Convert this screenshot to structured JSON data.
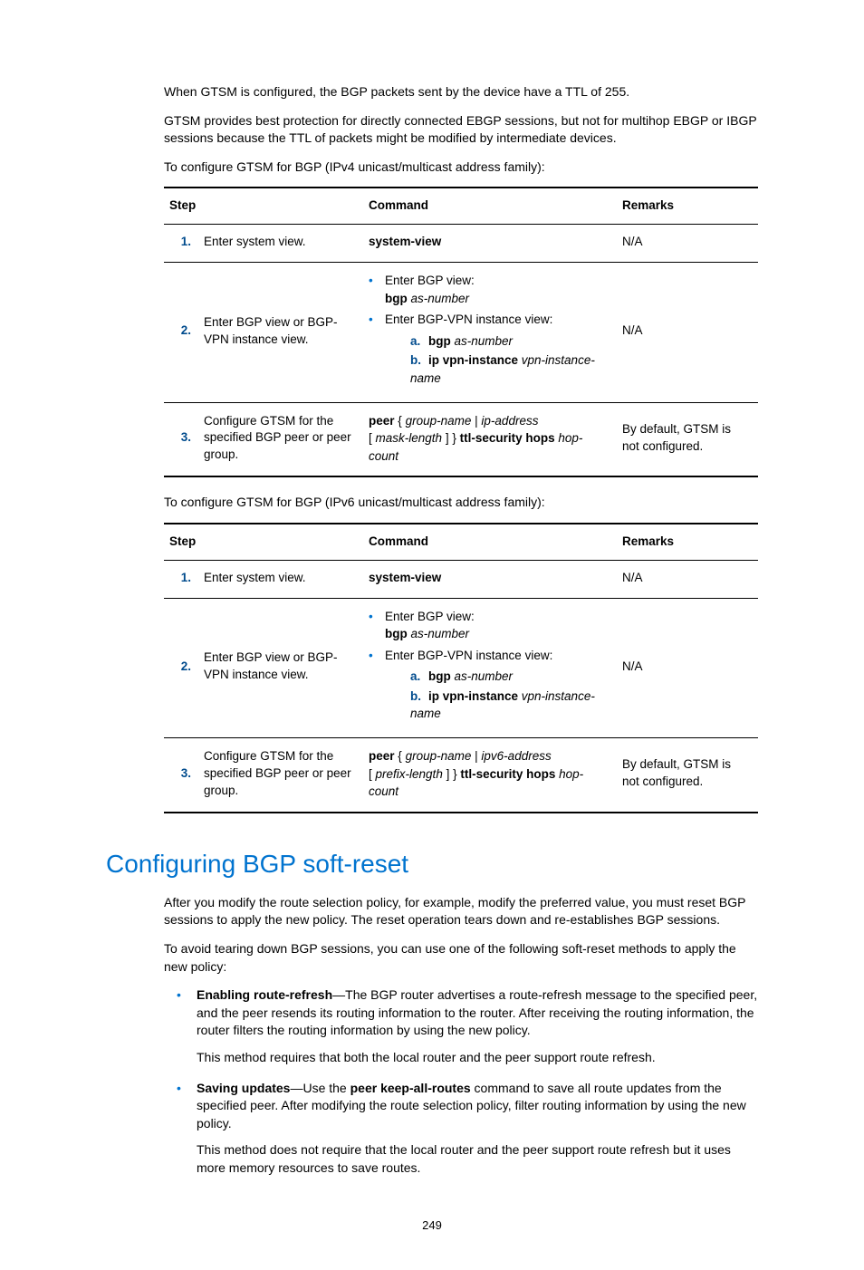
{
  "intro": {
    "p1": "When GTSM is configured, the BGP packets sent by the device have a TTL of 255.",
    "p2": "GTSM provides best protection for directly connected EBGP sessions, but not for multihop EBGP or IBGP sessions because the TTL of packets might be modified by intermediate devices.",
    "p3": "To configure GTSM for BGP (IPv4 unicast/multicast address family):",
    "p4": "To configure GTSM for BGP (IPv6 unicast/multicast address family):"
  },
  "tableHeaders": {
    "step": "Step",
    "command": "Command",
    "remarks": "Remarks"
  },
  "t1": {
    "r1": {
      "num": "1.",
      "step": "Enter system view.",
      "cmd": "system-view",
      "rem": "N/A"
    },
    "r2": {
      "num": "2.",
      "step": "Enter BGP view or BGP-VPN instance view.",
      "b1": "Enter BGP view:",
      "b1cmd": "bgp",
      "b1arg": "as-number",
      "b2": "Enter BGP-VPN instance view:",
      "sa_num": "a.",
      "sa_cmd": "bgp",
      "sa_arg": "as-number",
      "sb_num": "b.",
      "sb_cmd": "ip vpn-instance",
      "sb_arg": "vpn-instance-name",
      "rem": "N/A"
    },
    "r3": {
      "num": "3.",
      "step": "Configure GTSM for the specified BGP peer or peer group.",
      "c1": "peer",
      "c2": "{",
      "c3": "group-name",
      "c4": "|",
      "c5": "ip-address",
      "c6": "[",
      "c7": "mask-length",
      "c8": "] }",
      "c9": "ttl-security hops",
      "c10": "hop-count",
      "rem": "By default, GTSM is not configured."
    }
  },
  "t2": {
    "r1": {
      "num": "1.",
      "step": "Enter system view.",
      "cmd": "system-view",
      "rem": "N/A"
    },
    "r2": {
      "num": "2.",
      "step": "Enter BGP view or BGP-VPN instance view.",
      "b1": "Enter BGP view:",
      "b1cmd": "bgp",
      "b1arg": "as-number",
      "b2": "Enter BGP-VPN instance view:",
      "sa_num": "a.",
      "sa_cmd": "bgp",
      "sa_arg": "as-number",
      "sb_num": "b.",
      "sb_cmd": "ip vpn-instance",
      "sb_arg": "vpn-instance-name",
      "rem": "N/A"
    },
    "r3": {
      "num": "3.",
      "step": "Configure GTSM for the specified BGP peer or peer group.",
      "c1": "peer",
      "c2": "{",
      "c3": "group-name",
      "c4": "|",
      "c5": "ipv6-address",
      "c6": "[",
      "c7": "prefix-length",
      "c8": "] }",
      "c9": "ttl-security hops",
      "c10": "hop-count",
      "rem": "By default, GTSM is not configured."
    }
  },
  "section": {
    "title": "Configuring BGP soft-reset"
  },
  "soft": {
    "p1": "After you modify the route selection policy, for example, modify the preferred value, you must reset BGP sessions to apply the new policy. The reset operation tears down and re-establishes BGP sessions.",
    "p2": "To avoid tearing down BGP sessions, you can use one of the following soft-reset methods to apply the new policy:",
    "m1b": "Enabling route-refresh",
    "m1": "—The BGP router advertises a route-refresh message to the specified peer, and the peer resends its routing information to the router. After receiving the routing information, the router filters the routing information by using the new policy.",
    "m1s": "This method requires that both the local router and the peer support route refresh.",
    "m2b": "Saving updates",
    "m2a": "—Use the ",
    "m2cmd": "peer keep-all-routes",
    "m2c": " command to save all route updates from the specified peer. After modifying the route selection policy, filter routing information by using the new policy.",
    "m2s": "This method does not require that the local router and the peer support route refresh but it uses more memory resources to save routes."
  },
  "pageNumber": "249"
}
